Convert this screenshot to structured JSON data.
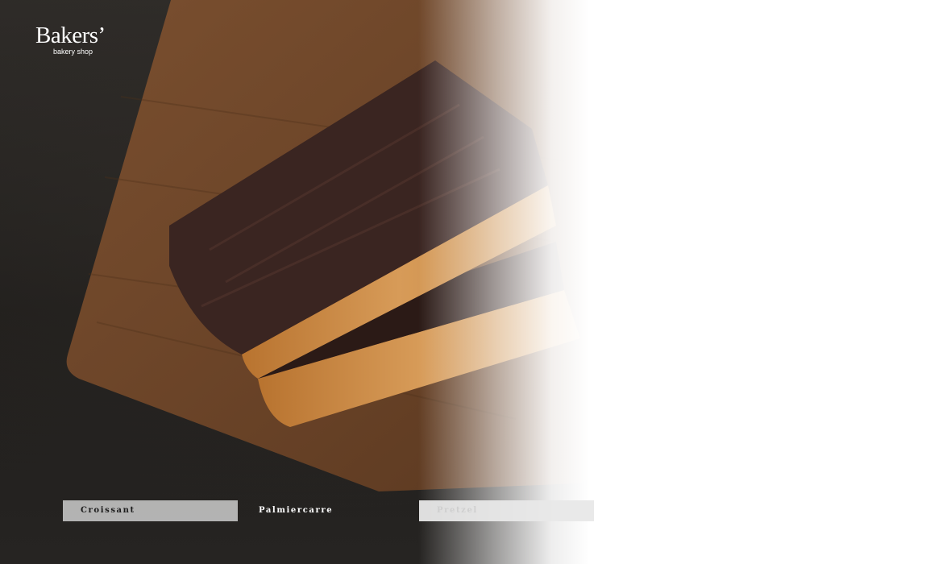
{
  "brand": {
    "name": "Bakers’",
    "tagline": "bakery shop"
  },
  "hero": {
    "image": "chocolate-dipped-palmier-on-wooden-board"
  },
  "tabs": [
    {
      "label": "Croissant",
      "state": "selected"
    },
    {
      "label": "Palmiercarre",
      "state": "normal"
    },
    {
      "label": "Pretzel",
      "state": "faded"
    }
  ],
  "colors": {
    "background_dark": "#23211f",
    "board": "#6b4428",
    "chocolate": "#3a2521",
    "pastry": "#c98a45",
    "text_light": "#ffffff"
  }
}
